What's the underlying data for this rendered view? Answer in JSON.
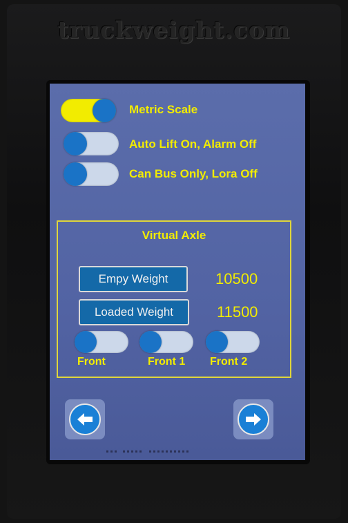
{
  "device": {
    "brand": "truckweight.com"
  },
  "settings": [
    {
      "label": "Metric Scale",
      "state": "on"
    },
    {
      "label": "Auto Lift On, Alarm Off",
      "state": "off"
    },
    {
      "label": "Can Bus Only, Lora Off",
      "state": "off"
    }
  ],
  "virtual_axle": {
    "title": "Virtual Axle",
    "empty_weight_label": "Empy Weight",
    "empty_weight_value": "10500",
    "loaded_weight_label": "Loaded Weight",
    "loaded_weight_value": "11500",
    "axles": [
      {
        "label": "Front",
        "state": "off"
      },
      {
        "label": "Front 1",
        "state": "off"
      },
      {
        "label": "Front 2",
        "state": "off"
      }
    ]
  },
  "nav": {
    "back_icon": "arrow-left-icon",
    "next_icon": "arrow-right-icon"
  },
  "colors": {
    "screen_bg": "#5565a6",
    "accent_yellow": "#f2ec00",
    "knob_blue": "#1a73c6",
    "button_blue": "#1469a8"
  }
}
